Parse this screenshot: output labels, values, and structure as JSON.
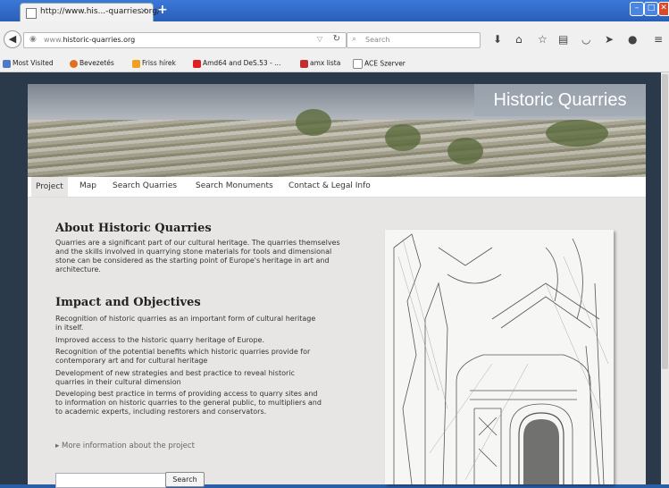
{
  "browser": {
    "tab_title": "http://www.his...-quarries.org/",
    "tab_close": "×",
    "new_tab": "+",
    "url_prefix": "www.",
    "url_domain": "historic-quarries.org",
    "search_placeholder": "Search",
    "toolbar_icons": [
      "download-icon",
      "home-icon",
      "star-icon",
      "reader-icon",
      "pocket-icon",
      "send-icon",
      "chat-icon",
      "menu-icon"
    ],
    "bookmarks": [
      "Most Visited",
      "Bevezetés",
      "Friss hírek",
      "Amd64 and DeS.53 - ...",
      "amx lista",
      "ACE Szerver"
    ]
  },
  "site": {
    "title": "Historic Quarries",
    "menu": [
      "Project",
      "Map",
      "Search Quarries",
      "Search Monuments",
      "Contact & Legal Info"
    ],
    "about_heading": "About Historic Quarries",
    "about_text": "Quarries are a significant part of our cultural heritage. The quarries themselves and the skills involved in quarrying stone materials for tools and dimensional stone can be considered as the starting point of Europe's heritage in art and architecture.",
    "impact_heading": "Impact and Objectives",
    "objectives": [
      "Recognition of historic quarries as an important form of cultural heritage in itself.",
      "Improved access to the historic quarry heritage of Europe.",
      "Recognition of the potential benefits which historic quarries provide for contemporary art and for cultural heritage",
      "Development of new strategies and best practice to reveal historic quarries in their cultural dimension",
      "Developing best practice in terms of providing access to quarry sites and to information on historic quarries to the general public, to multipliers and to academic experts, including restorers and conservators."
    ],
    "more_link": "More information about the project",
    "more_arrow": "▸",
    "search_button": "Search",
    "search_value": ""
  },
  "colors": {
    "titlebar": "#2a5fb8",
    "page_bg": "#e8e6e4",
    "close": "#d84a2a"
  }
}
